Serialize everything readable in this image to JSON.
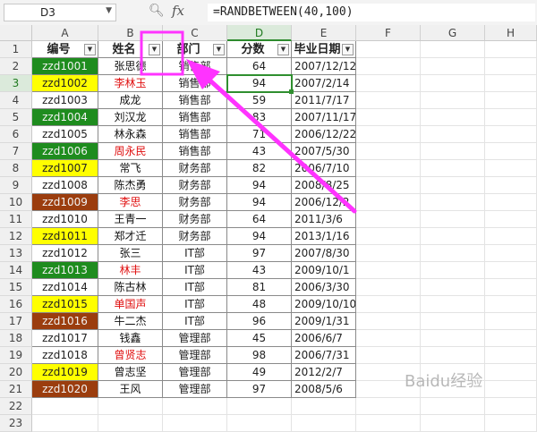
{
  "formula_bar": {
    "name_box": "D3",
    "formula": "=RANDBETWEEN(40,100)"
  },
  "columns": [
    "A",
    "B",
    "C",
    "D",
    "E",
    "F",
    "G",
    "H"
  ],
  "rows": [
    "1",
    "2",
    "3",
    "4",
    "5",
    "6",
    "7",
    "8",
    "9",
    "10",
    "11",
    "12",
    "13",
    "14",
    "15",
    "16",
    "17",
    "18",
    "19",
    "20",
    "21",
    "22",
    "23"
  ],
  "table": {
    "headers": [
      "编号",
      "姓名",
      "部门",
      "分数",
      "毕业日期"
    ],
    "records": [
      {
        "id": "zzd1001",
        "name": "张思德",
        "dept": "销售部",
        "score": "64",
        "date": "2007/12/12",
        "fill": "#1e8c1e",
        "name_color": "#111111"
      },
      {
        "id": "zzd1002",
        "name": "李林玉",
        "dept": "销售部",
        "score": "94",
        "date": "2007/2/14",
        "fill": "#ffff00",
        "name_color": "#e01010"
      },
      {
        "id": "zzd1003",
        "name": "成龙",
        "dept": "销售部",
        "score": "59",
        "date": "2011/7/17",
        "fill": "",
        "name_color": "#111111"
      },
      {
        "id": "zzd1004",
        "name": "刘汉龙",
        "dept": "销售部",
        "score": "83",
        "date": "2007/11/17",
        "fill": "#1e8c1e",
        "name_color": "#111111"
      },
      {
        "id": "zzd1005",
        "name": "林永森",
        "dept": "销售部",
        "score": "71",
        "date": "2006/12/22",
        "fill": "",
        "name_color": "#111111"
      },
      {
        "id": "zzd1006",
        "name": "周永民",
        "dept": "销售部",
        "score": "43",
        "date": "2007/5/30",
        "fill": "#1e8c1e",
        "name_color": "#e01010"
      },
      {
        "id": "zzd1007",
        "name": "常飞",
        "dept": "财务部",
        "score": "82",
        "date": "2006/7/10",
        "fill": "#ffff00",
        "name_color": "#111111"
      },
      {
        "id": "zzd1008",
        "name": "陈杰勇",
        "dept": "财务部",
        "score": "94",
        "date": "2008/8/25",
        "fill": "",
        "name_color": "#111111"
      },
      {
        "id": "zzd1009",
        "name": "李思",
        "dept": "财务部",
        "score": "94",
        "date": "2006/12/2",
        "fill": "#9b3d0e",
        "name_color": "#e01010"
      },
      {
        "id": "zzd1010",
        "name": "王青一",
        "dept": "财务部",
        "score": "64",
        "date": "2011/3/6",
        "fill": "",
        "name_color": "#111111"
      },
      {
        "id": "zzd1011",
        "name": "郑才迁",
        "dept": "财务部",
        "score": "94",
        "date": "2013/1/16",
        "fill": "#ffff00",
        "name_color": "#111111"
      },
      {
        "id": "zzd1012",
        "name": "张三",
        "dept": "IT部",
        "score": "97",
        "date": "2007/8/30",
        "fill": "",
        "name_color": "#111111"
      },
      {
        "id": "zzd1013",
        "name": "林丰",
        "dept": "IT部",
        "score": "43",
        "date": "2009/10/1",
        "fill": "#1e8c1e",
        "name_color": "#e01010"
      },
      {
        "id": "zzd1014",
        "name": "陈古林",
        "dept": "IT部",
        "score": "81",
        "date": "2006/3/30",
        "fill": "",
        "name_color": "#111111"
      },
      {
        "id": "zzd1015",
        "name": "单国声",
        "dept": "IT部",
        "score": "48",
        "date": "2009/10/10",
        "fill": "#ffff00",
        "name_color": "#e01010"
      },
      {
        "id": "zzd1016",
        "name": "牛二杰",
        "dept": "IT部",
        "score": "96",
        "date": "2009/1/31",
        "fill": "#9b3d0e",
        "name_color": "#111111"
      },
      {
        "id": "zzd1017",
        "name": "钱鑫",
        "dept": "管理部",
        "score": "45",
        "date": "2006/6/7",
        "fill": "",
        "name_color": "#111111"
      },
      {
        "id": "zzd1018",
        "name": "曾贤志",
        "dept": "管理部",
        "score": "98",
        "date": "2006/7/31",
        "fill": "",
        "name_color": "#e01010"
      },
      {
        "id": "zzd1019",
        "name": "曾志坚",
        "dept": "管理部",
        "score": "49",
        "date": "2012/2/7",
        "fill": "#ffff00",
        "name_color": "#111111"
      },
      {
        "id": "zzd1020",
        "name": "王风",
        "dept": "管理部",
        "score": "97",
        "date": "2008/5/6",
        "fill": "#9b3d0e",
        "name_color": "#111111"
      }
    ]
  },
  "colors": {
    "selection": "#2f8f2f",
    "annotation": "#ff33ff"
  },
  "watermark": "Baidu经验"
}
